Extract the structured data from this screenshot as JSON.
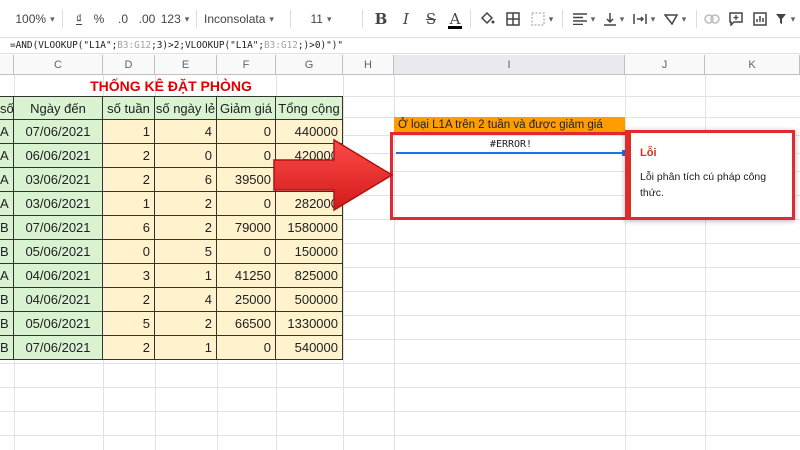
{
  "toolbar": {
    "zoom": "100%",
    "currency": "₫",
    "percent": "%",
    "decrease_decimal": ".0",
    "increase_decimal": ".00",
    "more_formats": "123",
    "font": "Inconsolata",
    "font_size": "11",
    "bold": "B",
    "italic": "I",
    "strike": "S",
    "text_color": "A"
  },
  "formula_bar": {
    "part1": "=AND(VLOOKUP(\"L1A\";",
    "range1": "B3:G12",
    "part2": ";3)>2;VLOOKUP(\"L1A\";",
    "range2": "B3:G12",
    "part3": ";)>0)\")\""
  },
  "columns": [
    "C",
    "D",
    "E",
    "F",
    "G",
    "H",
    "I",
    "J",
    "K"
  ],
  "title": "THỐNG KÊ ĐẶT PHÒNG",
  "table": {
    "headers": [
      "số",
      "Ngày đến",
      "số tuần",
      "số ngày lẻ",
      "Giảm giá",
      "Tổng cộng"
    ],
    "rows": [
      [
        "A",
        "07/06/2021",
        "1",
        "4",
        "0",
        "440000"
      ],
      [
        "A",
        "06/06/2021",
        "2",
        "0",
        "0",
        "420000"
      ],
      [
        "A",
        "03/06/2021",
        "2",
        "6",
        "39500",
        ""
      ],
      [
        "A",
        "03/06/2021",
        "1",
        "2",
        "0",
        "282000"
      ],
      [
        "B",
        "07/06/2021",
        "6",
        "2",
        "79000",
        "1580000"
      ],
      [
        "B",
        "05/06/2021",
        "0",
        "5",
        "0",
        "150000"
      ],
      [
        "A",
        "04/06/2021",
        "3",
        "1",
        "41250",
        "825000"
      ],
      [
        "B",
        "04/06/2021",
        "2",
        "4",
        "25000",
        "500000"
      ],
      [
        "B",
        "05/06/2021",
        "5",
        "2",
        "66500",
        "1330000"
      ],
      [
        "B",
        "07/06/2021",
        "2",
        "1",
        "0",
        "540000"
      ]
    ]
  },
  "criteria_label": "Ở loại L1A trên 2 tuần và được giảm giá",
  "error_value": "#ERROR!",
  "error_popup": {
    "title": "Lỗi",
    "message": "Lỗi phân tích cú pháp công thức."
  },
  "colors": {
    "header_green": "#d9f2d0",
    "data_yellow": "#fff2cc",
    "criteria_orange": "#ff9c00",
    "highlight_red": "#e02a33"
  }
}
